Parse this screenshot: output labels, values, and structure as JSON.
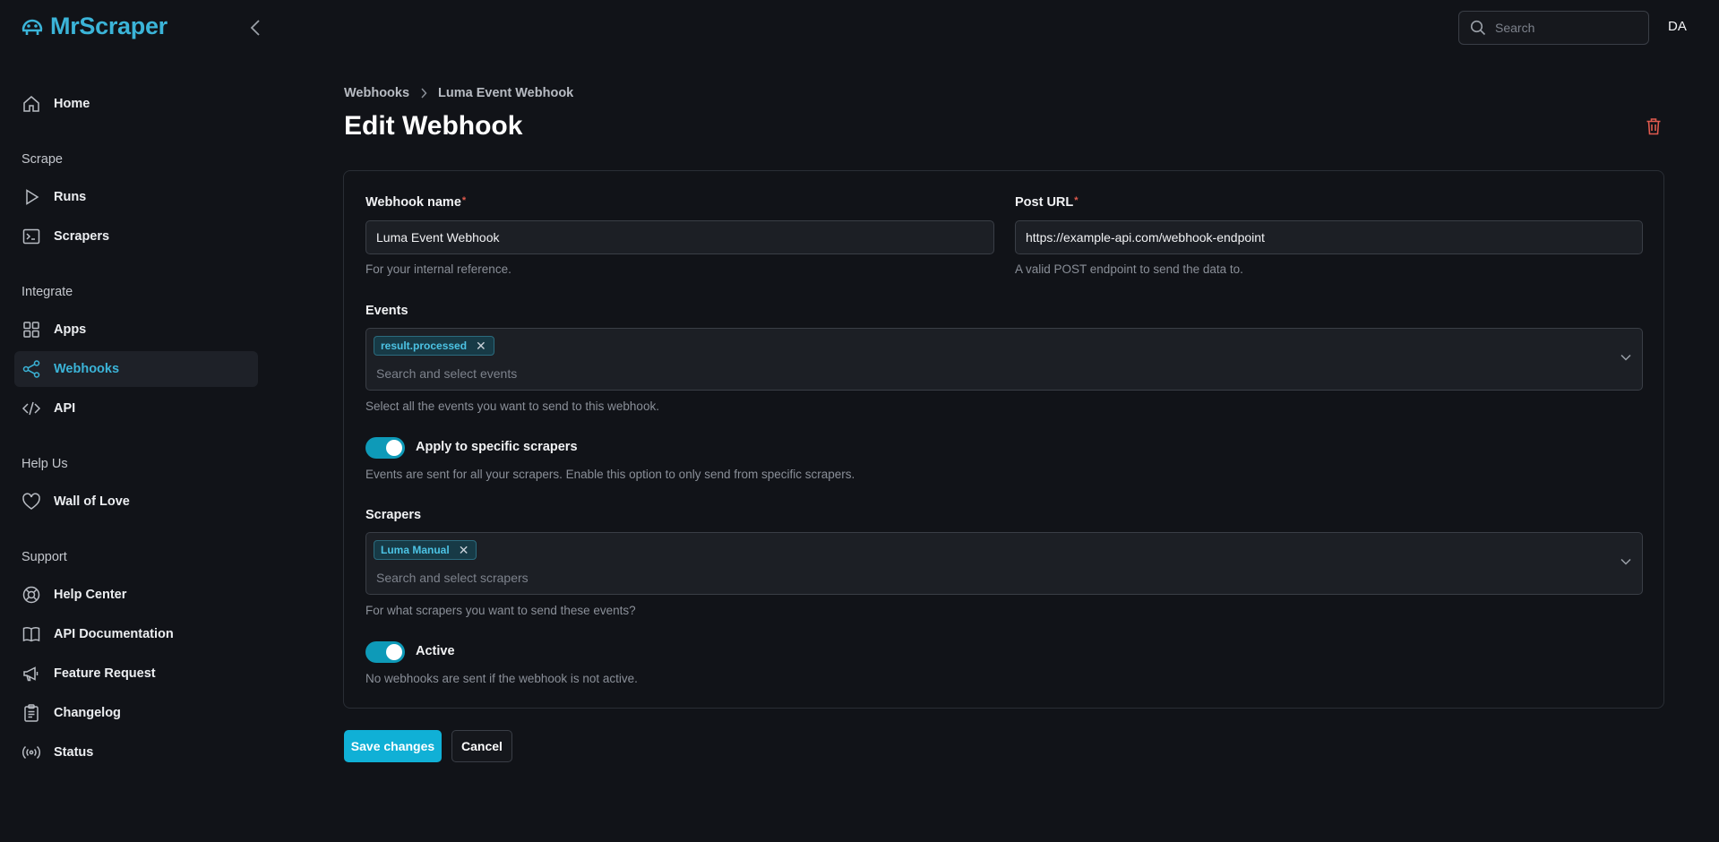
{
  "app": {
    "logo_text": "MrScraper",
    "avatar_initials": "DA"
  },
  "search": {
    "placeholder": "Search"
  },
  "sidebar": {
    "home": "Home",
    "section_scrape": "Scrape",
    "runs": "Runs",
    "scrapers": "Scrapers",
    "section_integrate": "Integrate",
    "apps": "Apps",
    "webhooks": "Webhooks",
    "api": "API",
    "section_help_us": "Help Us",
    "wall_of_love": "Wall of Love",
    "section_support": "Support",
    "help_center": "Help Center",
    "api_documentation": "API Documentation",
    "feature_request": "Feature Request",
    "changelog": "Changelog",
    "status": "Status"
  },
  "breadcrumb": {
    "parent": "Webhooks",
    "current": "Luma Event Webhook"
  },
  "page": {
    "title": "Edit Webhook"
  },
  "form": {
    "webhook_name": {
      "label": "Webhook name",
      "required_mark": "*",
      "value": "Luma Event Webhook",
      "help": "For your internal reference."
    },
    "post_url": {
      "label": "Post URL",
      "required_mark": "*",
      "value": "https://example-api.com/webhook-endpoint",
      "help": "A valid POST endpoint to send the data to."
    },
    "events": {
      "label": "Events",
      "tags": [
        "result.processed"
      ],
      "placeholder": "Search and select events",
      "help": "Select all the events you want to send to this webhook."
    },
    "apply_specific": {
      "label": "Apply to specific scrapers",
      "enabled": true,
      "help": "Events are sent for all your scrapers. Enable this option to only send from specific scrapers."
    },
    "scrapers": {
      "label": "Scrapers",
      "tags": [
        "Luma Manual"
      ],
      "placeholder": "Search and select scrapers",
      "help": "For what scrapers you want to send these events?"
    },
    "active": {
      "label": "Active",
      "enabled": true,
      "help": "No webhooks are sent if the webhook is not active."
    }
  },
  "actions": {
    "save": "Save changes",
    "cancel": "Cancel"
  },
  "colors": {
    "accent": "#3bb4d8",
    "primary_button": "#10b0d6",
    "toggle_on": "#0e9ab8",
    "danger": "#e05a4e",
    "background": "#111318"
  }
}
